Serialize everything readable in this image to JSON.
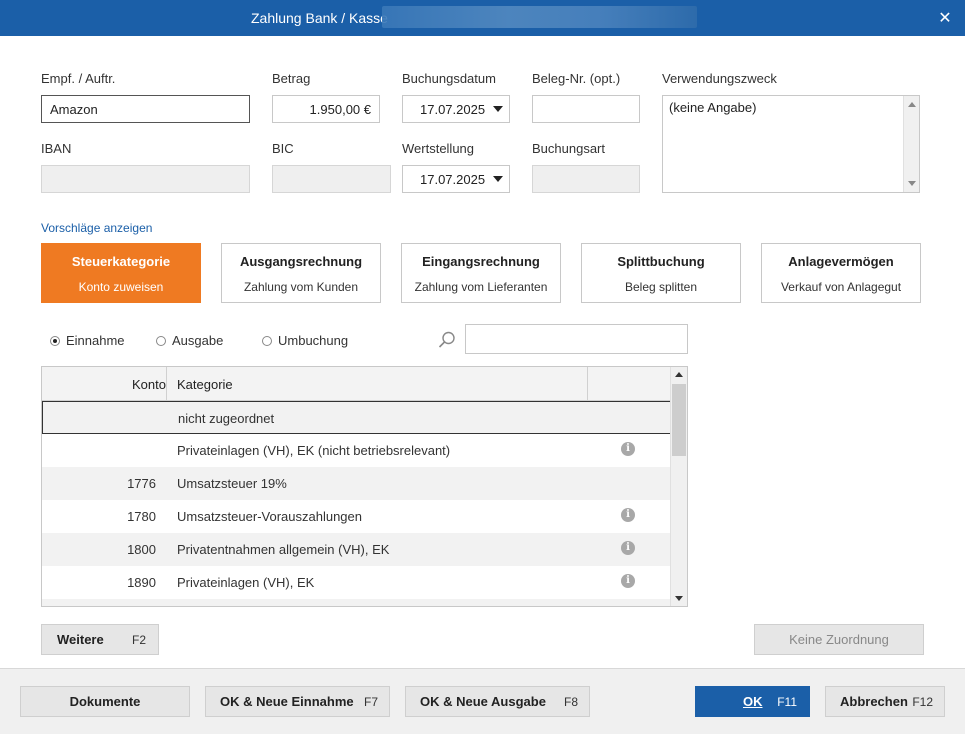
{
  "window": {
    "title": "Zahlung Bank / Kasse",
    "close_glyph": "✕"
  },
  "fields": {
    "empf_label": "Empf. / Auftr.",
    "empf_value": "Amazon",
    "betrag_label": "Betrag",
    "betrag_value": "1.950,00 €",
    "buchungsdatum_label": "Buchungsdatum",
    "buchungsdatum_value": "17.07.2025",
    "beleg_label": "Beleg-Nr. (opt.)",
    "beleg_value": "",
    "verwendung_label": "Verwendungszweck",
    "verwendung_value": "(keine Angabe)",
    "iban_label": "IBAN",
    "iban_value": "",
    "bic_label": "BIC",
    "bic_value": "",
    "wertstellung_label": "Wertstellung",
    "wertstellung_value": "17.07.2025",
    "buchungsart_label": "Buchungsart",
    "buchungsart_value": ""
  },
  "suggestions_link": "Vorschläge anzeigen",
  "cards": [
    {
      "title": "Steuerkategorie",
      "subtitle": "Konto zuweisen",
      "active": true
    },
    {
      "title": "Ausgangsrechnung",
      "subtitle": "Zahlung vom Kunden",
      "active": false
    },
    {
      "title": "Eingangsrechnung",
      "subtitle": "Zahlung vom Lieferanten",
      "active": false
    },
    {
      "title": "Splittbuchung",
      "subtitle": "Beleg splitten",
      "active": false
    },
    {
      "title": "Anlagevermögen",
      "subtitle": "Verkauf von Anlagegut",
      "active": false
    }
  ],
  "radios": [
    {
      "label": "Einnahme",
      "checked": true
    },
    {
      "label": "Ausgabe",
      "checked": false
    },
    {
      "label": "Umbuchung",
      "checked": false
    }
  ],
  "search": {
    "value": ""
  },
  "table": {
    "headers": {
      "konto": "Konto",
      "kategorie": "Kategorie"
    },
    "rows": [
      {
        "konto": "",
        "kategorie": "nicht zugeordnet",
        "info": false,
        "selected": true
      },
      {
        "konto": "",
        "kategorie": "Privateinlagen (VH), EK  (nicht betriebsrelevant)",
        "info": true
      },
      {
        "konto": "1776",
        "kategorie": "Umsatzsteuer 19%",
        "info": false
      },
      {
        "konto": "1780",
        "kategorie": "Umsatzsteuer-Vorauszahlungen",
        "info": true
      },
      {
        "konto": "1800",
        "kategorie": "Privatentnahmen allgemein (VH), EK",
        "info": true
      },
      {
        "konto": "1890",
        "kategorie": "Privateinlagen (VH), EK",
        "info": true
      }
    ],
    "info_glyph": "i"
  },
  "buttons": {
    "weitere": "Weitere",
    "weitere_key": "F2",
    "keine_zuordnung": "Keine Zuordnung",
    "dokumente": "Dokumente",
    "ok_neue_einnahme": "OK & Neue Einnahme",
    "ok_neue_einnahme_key": "F7",
    "ok_neue_ausgabe": "OK & Neue Ausgabe",
    "ok_neue_ausgabe_key": "F8",
    "ok": "OK",
    "ok_key": "F11",
    "abbrechen": "Abbrechen",
    "abbrechen_key": "F12"
  },
  "colors": {
    "accent_blue": "#1b5fa8",
    "accent_orange": "#ef7a22"
  }
}
